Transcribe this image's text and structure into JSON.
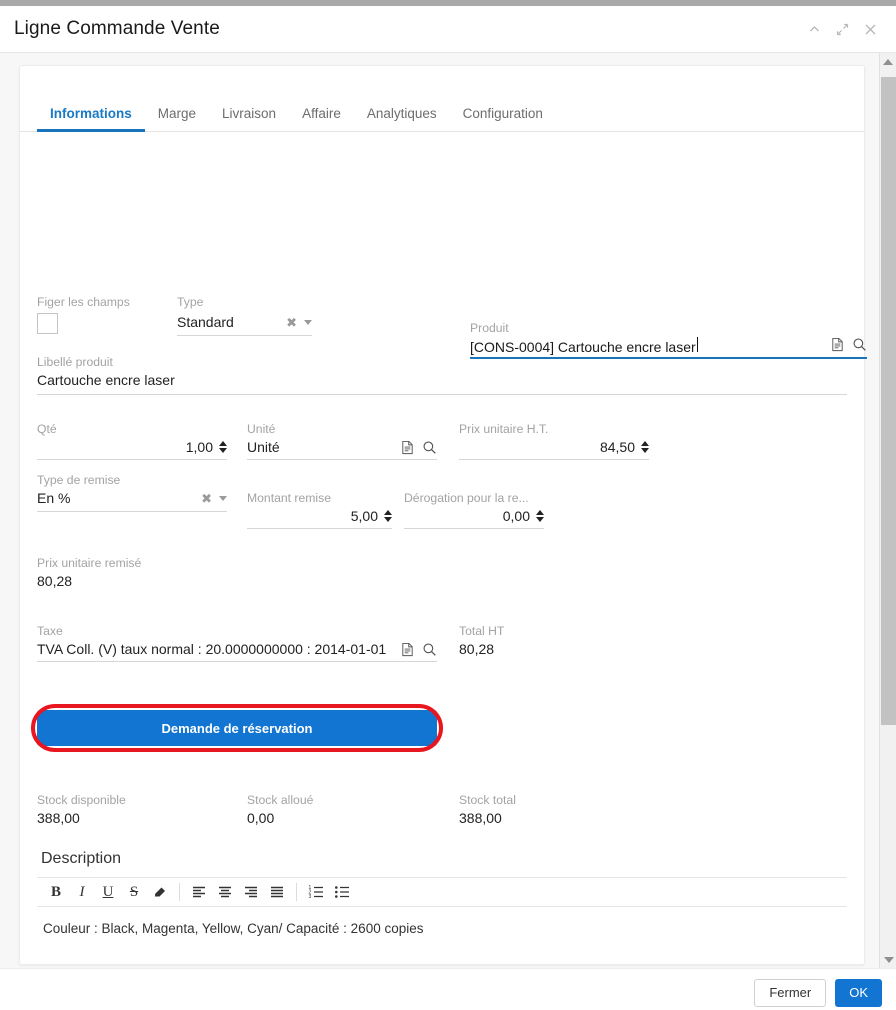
{
  "window": {
    "title": "Ligne Commande Vente",
    "controls": [
      {
        "name": "collapse-icon",
        "glyph": "chevron-up"
      },
      {
        "name": "expand-icon",
        "glyph": "expand-arrows"
      },
      {
        "name": "close-icon",
        "glyph": "x"
      }
    ]
  },
  "tabs": [
    {
      "label": "Informations",
      "active": true
    },
    {
      "label": "Marge",
      "active": false
    },
    {
      "label": "Livraison",
      "active": false
    },
    {
      "label": "Affaire",
      "active": false
    },
    {
      "label": "Analytiques",
      "active": false
    },
    {
      "label": "Configuration",
      "active": false
    }
  ],
  "form": {
    "produit": {
      "label": "Produit",
      "value": "[CONS-0004] Cartouche encre laser"
    },
    "figer": {
      "label": "Figer les champs",
      "checked": false
    },
    "type": {
      "label": "Type",
      "value": "Standard"
    },
    "libelle": {
      "label": "Libellé produit",
      "value": "Cartouche encre laser"
    },
    "qte": {
      "label": "Qté",
      "value": "1,00"
    },
    "unite": {
      "label": "Unité",
      "value": "Unité"
    },
    "prix_unitaire": {
      "label": "Prix unitaire H.T.",
      "value": "84,50"
    },
    "type_remise": {
      "label": "Type de remise",
      "value": "En %"
    },
    "montant_remise": {
      "label": "Montant remise",
      "value": "5,00"
    },
    "derogation": {
      "label": "Dérogation pour la re...",
      "value": "0,00"
    },
    "prix_remise": {
      "label": "Prix unitaire remisé",
      "value": "80,28"
    },
    "taxe": {
      "label": "Taxe",
      "value": "TVA Coll. (V) taux normal : 20.0000000000 : 2014-01-01"
    },
    "total_ht": {
      "label": "Total HT",
      "value": "80,28"
    },
    "reservation_button": "Demande de réservation",
    "stock_disponible": {
      "label": "Stock disponible",
      "value": "388,00"
    },
    "stock_alloue": {
      "label": "Stock alloué",
      "value": "0,00"
    },
    "stock_total": {
      "label": "Stock total",
      "value": "388,00"
    }
  },
  "description": {
    "title": "Description",
    "text": "Couleur : Black, Magenta, Yellow, Cyan/ Capacité : 2600 copies",
    "toolbar": [
      {
        "name": "bold-icon",
        "label": "B"
      },
      {
        "name": "italic-icon",
        "label": "I"
      },
      {
        "name": "underline-icon",
        "label": "U"
      },
      {
        "name": "strikethrough-icon",
        "label": "S"
      },
      {
        "name": "eraser-icon",
        "label": ""
      },
      {
        "name": "align-left-icon",
        "label": ""
      },
      {
        "name": "align-center-icon",
        "label": ""
      },
      {
        "name": "align-right-icon",
        "label": ""
      },
      {
        "name": "align-justify-icon",
        "label": ""
      },
      {
        "name": "ordered-list-icon",
        "label": ""
      },
      {
        "name": "unordered-list-icon",
        "label": ""
      }
    ]
  },
  "footer": {
    "close_label": "Fermer",
    "ok_label": "OK"
  },
  "colors": {
    "accent": "#1275d1",
    "tab_active": "#1874bd",
    "highlight_ring": "#e8161f",
    "label_grey": "#a3a3a3"
  }
}
